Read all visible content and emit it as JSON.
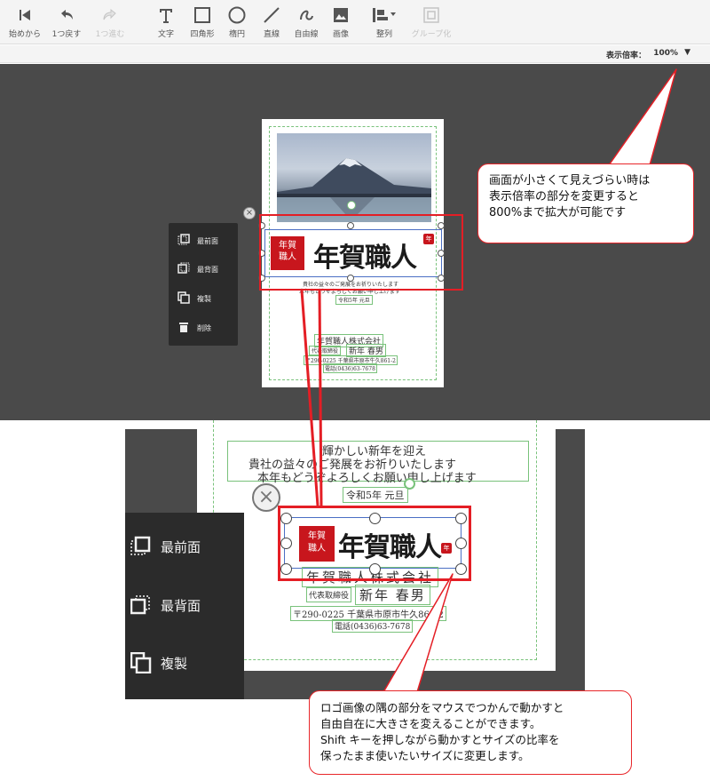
{
  "toolbar": {
    "items": [
      {
        "id": "first",
        "label": "始めから",
        "icon": "skip-to-start-icon",
        "enabled": true
      },
      {
        "id": "undo",
        "label": "1つ戻す",
        "icon": "undo-icon",
        "enabled": true
      },
      {
        "id": "redo",
        "label": "1つ進む",
        "icon": "redo-icon",
        "enabled": false
      },
      {
        "id": "text",
        "label": "文字",
        "icon": "text-icon",
        "enabled": true
      },
      {
        "id": "rect",
        "label": "四角形",
        "icon": "rectangle-icon",
        "enabled": true
      },
      {
        "id": "ellipse",
        "label": "楕円",
        "icon": "ellipse-icon",
        "enabled": true
      },
      {
        "id": "line",
        "label": "直線",
        "icon": "line-icon",
        "enabled": true
      },
      {
        "id": "freehand",
        "label": "自由線",
        "icon": "freehand-icon",
        "enabled": true
      },
      {
        "id": "image",
        "label": "画像",
        "icon": "image-icon",
        "enabled": true
      },
      {
        "id": "align",
        "label": "整列",
        "icon": "align-icon",
        "enabled": true
      },
      {
        "id": "group",
        "label": "グループ化",
        "icon": "group-icon",
        "enabled": false
      }
    ]
  },
  "zoom": {
    "label": "表示倍率：",
    "value": "100%",
    "arrow": "▼"
  },
  "context_menu": {
    "items": [
      {
        "label": "最前面",
        "icon": "bring-to-front-icon"
      },
      {
        "label": "最背面",
        "icon": "send-to-back-icon"
      },
      {
        "label": "複製",
        "icon": "duplicate-icon"
      },
      {
        "label": "削除",
        "icon": "trash-icon"
      }
    ]
  },
  "card": {
    "logo_stamp": "年賀\n職人",
    "logo_text": "年賀職人",
    "seal": "年",
    "greeting_lines": [
      "輝かしい新年を迎え",
      "貴社の益々のご発展をお祈りいたします",
      "本年もどうぞよろしくお願い申し上げます"
    ],
    "date": "令和5年 元旦",
    "company": "年賀職人株式会社",
    "title_label": "代表取締役",
    "rep_name": "新年 春男",
    "address": "〒290-0225 千葉県市原市牛久861-2",
    "phone": "電話(0436)63-7678",
    "small_greeting_1": "貴社の益々のご発展をお祈りいたします",
    "small_greeting_2": "本年もどうぞよろしくお願い申し上げます",
    "small_date": "令和5年 元旦",
    "small_address": "〒290-0225 千葉県市原市牛久861-2",
    "small_phone": "電話(0436)63-7678"
  },
  "callouts": {
    "zoom_tip": "画面が小さくて見えづらい時は\n表示倍率の部分を変更すると\n800%まで拡大が可能です",
    "resize_tip": "ロゴ画像の隅の部分をマウスでつかんで動かすと\n自由自在に大きさを変えることができます。\nShift キーを押しながら動かすとサイズの比率を\n保ったまま使いたいサイズに変更します。"
  },
  "colors": {
    "accent_red": "#e41e25",
    "stamp_red": "#c8161d",
    "selection_blue": "#4b6fc4",
    "guide_green": "#79c27b",
    "canvas_gray": "#4a4a4a"
  }
}
